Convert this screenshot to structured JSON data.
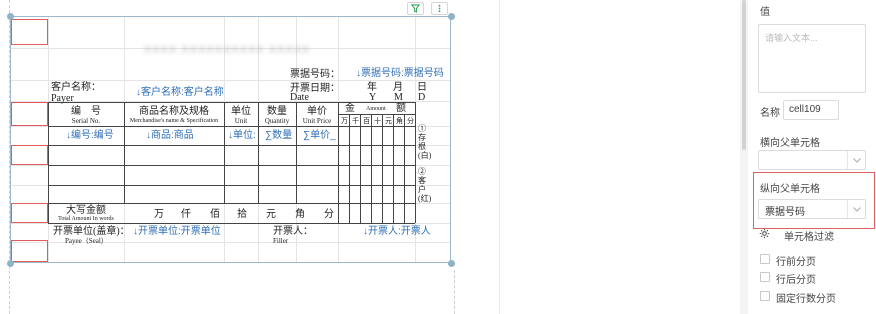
{
  "toolbar": {
    "filter_icon": "filter-icon",
    "more_icon": "more-vertical-icon"
  },
  "report": {
    "blurred_title": "XXXX  XXXXXXXXXX  XXXXX",
    "invoice_no_label": "票据号码：",
    "invoice_no_field": "↓票据号码:票据号码",
    "customer_label_cn": "客户名称：",
    "customer_label_en": "Payer",
    "customer_field": "↓客户名称:客户名称",
    "date_label_cn": "开票日期：",
    "date_label_en": "Date",
    "date_year": "年",
    "date_month": "月",
    "date_day": "日",
    "date_y": "Y",
    "date_m": "M",
    "date_d": "D",
    "col_no_cn": "编　号",
    "col_no_en": "Serial No.",
    "col_goods_cn": "商品名称及规格",
    "col_goods_en": "Merchandise's name & Specification",
    "col_unit_cn": "单位",
    "col_unit_en": "Unit",
    "col_qty_cn": "数量",
    "col_qty_en": "Quantity",
    "col_price_cn": "单价",
    "col_price_en": "Unit Price",
    "col_amount_cn1": "金",
    "col_amount_en": "Amount",
    "col_amount_cn2": "额",
    "digits": [
      "万",
      "千",
      "百",
      "十",
      "元",
      "角",
      "分"
    ],
    "field_no": "↓编号:编号",
    "field_goods": "↓商品:商品",
    "field_unit": "↓单位:",
    "field_qty": "∑数量",
    "field_price": "∑单价_",
    "side_note_1": "①存根(白)",
    "side_note_2": "②客户(红)",
    "total_cn": "大写金额",
    "total_en": "Total Amount In words",
    "total_units": [
      "万",
      "仟",
      "佰",
      "拾",
      "元",
      "角",
      "分"
    ],
    "payee_label_cn": "开票单位(盖章)：",
    "payee_label_en": "Payee（Seal）",
    "payee_field": "↓开票单位:开票单位",
    "filler_label_cn": "开票人：",
    "filler_label_en": "Filler",
    "filler_field": "↓开票人:开票人"
  },
  "panel": {
    "value_label": "值",
    "value_placeholder": "请输入文本...",
    "name_label": "名称",
    "name_value": "cell109",
    "h_parent_label": "横向父单元格",
    "h_parent_value": "",
    "v_parent_label": "纵向父单元格",
    "v_parent_value": "票据号码",
    "cell_filter_label": "单元格过滤",
    "cell_filter_icon": "gear-icon",
    "page_break_before": "行前分页",
    "page_break_after": "行后分页",
    "fixed_rows_paging": "固定行数分页",
    "accent_red": "#e06060",
    "field_blue": "#2f6fb7"
  }
}
